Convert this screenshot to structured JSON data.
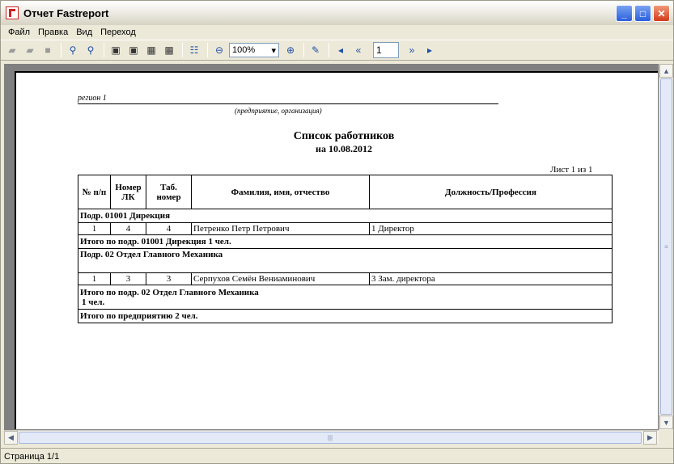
{
  "window": {
    "title": "Отчет Fastreport"
  },
  "menu": [
    "Файл",
    "Правка",
    "Вид",
    "Переход"
  ],
  "toolbar": {
    "zoom": "100%",
    "page_number": "1"
  },
  "report": {
    "region": "регион 1",
    "org_caption": "(предприятие, организация)",
    "title": "Список работников",
    "date_line": "на 10.08.2012",
    "sheet": "Лист  1  из  1",
    "headers": [
      "№ п/п",
      "Номер ЛК",
      "Таб. номер",
      "Фамилия, имя, отчество",
      "Должность/Профессия"
    ],
    "group1": "Подр.  01001 Дирекция",
    "row1": [
      "1",
      "4",
      "4",
      "Петренко Петр Петрович",
      "1 Директор"
    ],
    "total1": "Итого по подр.  01001 Дирекция 1  чел.",
    "group2": "Подр.  02 Отдел Главного Механика",
    "row2": [
      "1",
      "3",
      "3",
      "Серпухов Семён Вениаминович",
      "3 Зам. директора"
    ],
    "total2_line1": "Итого по подр.  02 Отдел Главного Механика",
    "total2_line2": "1  чел.",
    "grand_total": "Итого по предприятию 2 чел."
  },
  "status": {
    "text": "Страница 1/1"
  }
}
